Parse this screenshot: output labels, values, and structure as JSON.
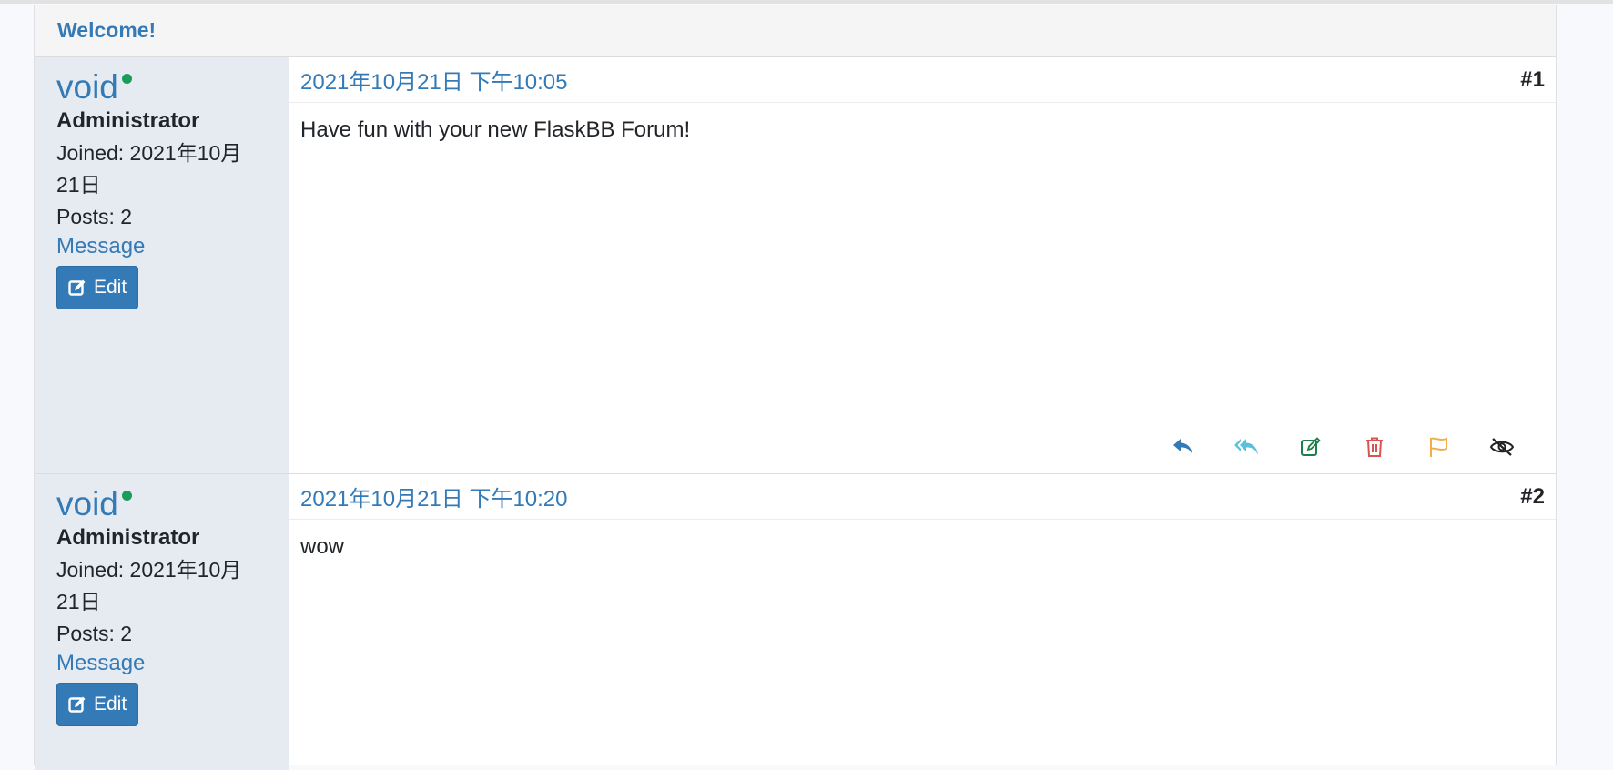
{
  "topic": {
    "title": "Welcome!"
  },
  "posts": [
    {
      "author": {
        "username": "void",
        "role": "Administrator",
        "joined": "Joined: 2021年10月\n21日",
        "posts": "Posts: 2",
        "message_label": "Message",
        "edit_label": "Edit"
      },
      "date": "2021年10月21日 下午10:05",
      "number": "#1",
      "body": "Have fun with your new FlaskBB Forum!",
      "actions": [
        "reply-icon",
        "quote-icon",
        "edit-icon",
        "delete-icon",
        "report-flag-icon",
        "hide-icon"
      ]
    },
    {
      "author": {
        "username": "void",
        "role": "Administrator",
        "joined": "Joined: 2021年10月\n21日",
        "posts": "Posts: 2",
        "message_label": "Message",
        "edit_label": "Edit"
      },
      "date": "2021年10月21日 下午10:20",
      "number": "#2",
      "body": "wow"
    }
  ],
  "colors": {
    "link": "#337ab7",
    "online": "#1a9c5a",
    "reply": "#337ab7",
    "quote": "#5bc0de",
    "edit": "#1e7e4a",
    "delete": "#d9534f",
    "report": "#f0ad4e",
    "hide": "#222222"
  }
}
